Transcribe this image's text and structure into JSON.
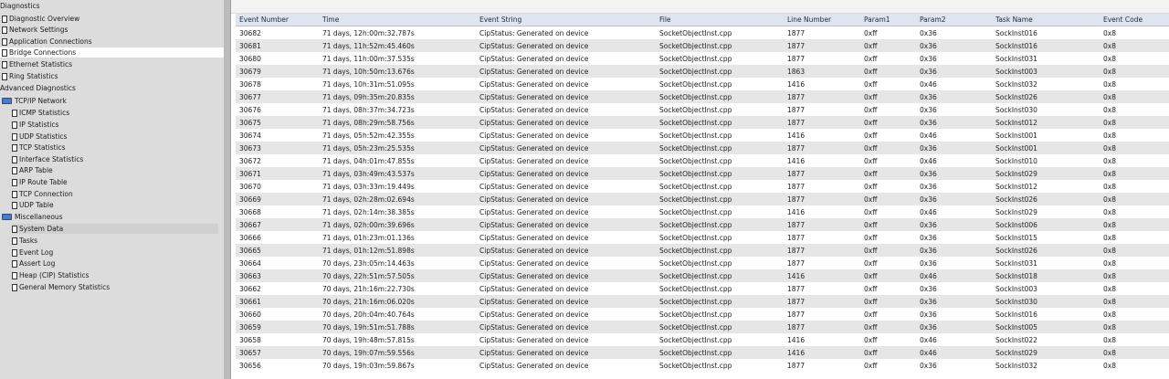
{
  "tree": {
    "items": [
      {
        "label": "Diagnostics",
        "icon": "none"
      },
      {
        "label": "Diagnostic Overview",
        "icon": "document-icon"
      },
      {
        "label": "Network Settings",
        "icon": "document-icon"
      },
      {
        "label": "Application Connections",
        "icon": "document-icon"
      },
      {
        "label": "Bridge Connections",
        "icon": "document-icon"
      },
      {
        "label": "Ethernet Statistics",
        "icon": "document-icon"
      },
      {
        "label": "Ring Statistics",
        "icon": "document-icon"
      },
      {
        "label": "Advanced Diagnostics",
        "icon": "none"
      },
      {
        "label": "TCP/IP Network",
        "icon": "folder-icon"
      },
      {
        "label": "ICMP Statistics",
        "icon": "document-icon"
      },
      {
        "label": "IP Statistics",
        "icon": "document-icon"
      },
      {
        "label": "UDP Statistics",
        "icon": "document-icon"
      },
      {
        "label": "TCP Statistics",
        "icon": "document-icon"
      },
      {
        "label": "Interface Statistics",
        "icon": "document-icon"
      },
      {
        "label": "ARP Table",
        "icon": "document-icon"
      },
      {
        "label": "IP Route Table",
        "icon": "document-icon"
      },
      {
        "label": "TCP Connection",
        "icon": "document-icon"
      },
      {
        "label": "UDP Table",
        "icon": "document-icon"
      },
      {
        "label": "Miscellaneous",
        "icon": "folder-icon"
      },
      {
        "label": "System Data",
        "icon": "document-icon"
      },
      {
        "label": "Tasks",
        "icon": "document-icon"
      },
      {
        "label": "Event Log",
        "icon": "document-icon"
      },
      {
        "label": "Assert Log",
        "icon": "document-icon"
      },
      {
        "label": "Heap (CIP) Statistics",
        "icon": "document-icon"
      },
      {
        "label": "General Memory Statistics",
        "icon": "document-icon"
      }
    ],
    "selected": "Bridge Connections",
    "highlighted": "System Data"
  },
  "table": {
    "columns": [
      "Event Number",
      "Time",
      "Event String",
      "File",
      "Line Number",
      "Param1",
      "Param2",
      "Task Name",
      "Event Code"
    ],
    "rows": [
      [
        "30682",
        "71 days, 12h:00m:32.787s",
        "CipStatus: Generated on device",
        "SocketObjectInst.cpp",
        "1877",
        "0xff",
        "0x36",
        "SockInst016",
        "0x8"
      ],
      [
        "30681",
        "71 days, 11h:52m:45.460s",
        "CipStatus: Generated on device",
        "SocketObjectInst.cpp",
        "1877",
        "0xff",
        "0x36",
        "SockInst016",
        "0x8"
      ],
      [
        "30680",
        "71 days, 11h:00m:37.535s",
        "CipStatus: Generated on device",
        "SocketObjectInst.cpp",
        "1877",
        "0xff",
        "0x36",
        "SockInst031",
        "0x8"
      ],
      [
        "30679",
        "71 days, 10h:50m:13.676s",
        "CipStatus: Generated on device",
        "SocketObjectInst.cpp",
        "1863",
        "0xff",
        "0x36",
        "SockInst003",
        "0x8"
      ],
      [
        "30678",
        "71 days, 10h:31m:51.095s",
        "CipStatus: Generated on device",
        "SocketObjectInst.cpp",
        "1416",
        "0xff",
        "0x46",
        "SockInst032",
        "0x8"
      ],
      [
        "30677",
        "71 days, 09h:35m:20.835s",
        "CipStatus: Generated on device",
        "SocketObjectInst.cpp",
        "1877",
        "0xff",
        "0x36",
        "SockInst026",
        "0x8"
      ],
      [
        "30676",
        "71 days, 08h:37m:34.723s",
        "CipStatus: Generated on device",
        "SocketObjectInst.cpp",
        "1877",
        "0xff",
        "0x36",
        "SockInst030",
        "0x8"
      ],
      [
        "30675",
        "71 days, 08h:29m:58.756s",
        "CipStatus: Generated on device",
        "SocketObjectInst.cpp",
        "1877",
        "0xff",
        "0x36",
        "SockInst012",
        "0x8"
      ],
      [
        "30674",
        "71 days, 05h:52m:42.355s",
        "CipStatus: Generated on device",
        "SocketObjectInst.cpp",
        "1416",
        "0xff",
        "0x46",
        "SockInst001",
        "0x8"
      ],
      [
        "30673",
        "71 days, 05h:23m:25.535s",
        "CipStatus: Generated on device",
        "SocketObjectInst.cpp",
        "1877",
        "0xff",
        "0x36",
        "SockInst001",
        "0x8"
      ],
      [
        "30672",
        "71 days, 04h:01m:47.855s",
        "CipStatus: Generated on device",
        "SocketObjectInst.cpp",
        "1416",
        "0xff",
        "0x46",
        "SockInst010",
        "0x8"
      ],
      [
        "30671",
        "71 days, 03h:49m:43.537s",
        "CipStatus: Generated on device",
        "SocketObjectInst.cpp",
        "1877",
        "0xff",
        "0x36",
        "SockInst029",
        "0x8"
      ],
      [
        "30670",
        "71 days, 03h:33m:19.449s",
        "CipStatus: Generated on device",
        "SocketObjectInst.cpp",
        "1877",
        "0xff",
        "0x36",
        "SockInst012",
        "0x8"
      ],
      [
        "30669",
        "71 days, 02h:28m:02.694s",
        "CipStatus: Generated on device",
        "SocketObjectInst.cpp",
        "1877",
        "0xff",
        "0x36",
        "SockInst026",
        "0x8"
      ],
      [
        "30668",
        "71 days, 02h:14m:38.385s",
        "CipStatus: Generated on device",
        "SocketObjectInst.cpp",
        "1416",
        "0xff",
        "0x46",
        "SockInst029",
        "0x8"
      ],
      [
        "30667",
        "71 days, 02h:00m:39.696s",
        "CipStatus: Generated on device",
        "SocketObjectInst.cpp",
        "1877",
        "0xff",
        "0x36",
        "SockInst006",
        "0x8"
      ],
      [
        "30666",
        "71 days, 01h:23m:01.136s",
        "CipStatus: Generated on device",
        "SocketObjectInst.cpp",
        "1877",
        "0xff",
        "0x36",
        "SockInst015",
        "0x8"
      ],
      [
        "30665",
        "71 days, 01h:12m:51.898s",
        "CipStatus: Generated on device",
        "SocketObjectInst.cpp",
        "1877",
        "0xff",
        "0x36",
        "SockInst026",
        "0x8"
      ],
      [
        "30664",
        "70 days, 23h:05m:14.463s",
        "CipStatus: Generated on device",
        "SocketObjectInst.cpp",
        "1877",
        "0xff",
        "0x36",
        "SockInst031",
        "0x8"
      ],
      [
        "30663",
        "70 days, 22h:51m:57.505s",
        "CipStatus: Generated on device",
        "SocketObjectInst.cpp",
        "1416",
        "0xff",
        "0x46",
        "SockInst018",
        "0x8"
      ],
      [
        "30662",
        "70 days, 21h:16m:22.730s",
        "CipStatus: Generated on device",
        "SocketObjectInst.cpp",
        "1877",
        "0xff",
        "0x36",
        "SockInst003",
        "0x8"
      ],
      [
        "30661",
        "70 days, 21h:16m:06.020s",
        "CipStatus: Generated on device",
        "SocketObjectInst.cpp",
        "1877",
        "0xff",
        "0x36",
        "SockInst030",
        "0x8"
      ],
      [
        "30660",
        "70 days, 20h:04m:40.764s",
        "CipStatus: Generated on device",
        "SocketObjectInst.cpp",
        "1877",
        "0xff",
        "0x36",
        "SockInst016",
        "0x8"
      ],
      [
        "30659",
        "70 days, 19h:51m:51.788s",
        "CipStatus: Generated on device",
        "SocketObjectInst.cpp",
        "1877",
        "0xff",
        "0x36",
        "SockInst005",
        "0x8"
      ],
      [
        "30658",
        "70 days, 19h:48m:57.815s",
        "CipStatus: Generated on device",
        "SocketObjectInst.cpp",
        "1416",
        "0xff",
        "0x46",
        "SockInst022",
        "0x8"
      ],
      [
        "30657",
        "70 days, 19h:07m:59.556s",
        "CipStatus: Generated on device",
        "SocketObjectInst.cpp",
        "1416",
        "0xff",
        "0x46",
        "SockInst029",
        "0x8"
      ],
      [
        "30656",
        "70 days, 19h:03m:59.867s",
        "CipStatus: Generated on device",
        "SocketObjectInst.cpp",
        "1877",
        "0xff",
        "0x36",
        "SockInst032",
        "0x8"
      ]
    ]
  }
}
